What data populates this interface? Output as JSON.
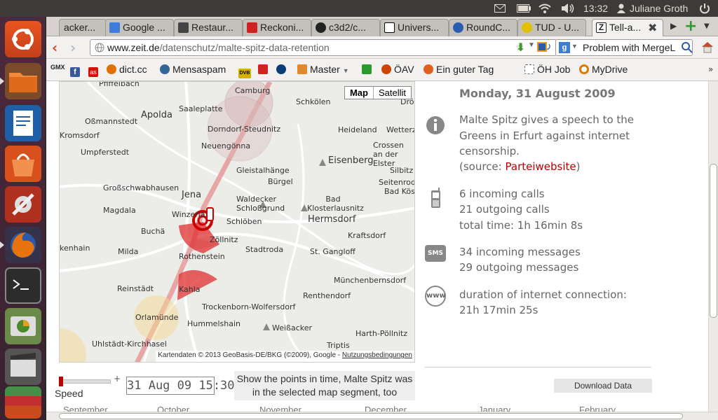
{
  "system": {
    "time": "13:32",
    "user": "Juliane Groth"
  },
  "tabs": [
    {
      "label": "acker...",
      "fav_color": "#555555"
    },
    {
      "label": "Google ...",
      "fav_color": "#3b7dd8"
    },
    {
      "label": "Restaur...",
      "fav_color": "#444444"
    },
    {
      "label": "Reckoni...",
      "fav_color": "#cc2222"
    },
    {
      "label": "c3d2/c...",
      "fav_color": "#222222"
    },
    {
      "label": "Univers...",
      "fav_color": "#000000"
    },
    {
      "label": "RoundC...",
      "fav_color": "#2a5db0"
    },
    {
      "label": "TUD - U...",
      "fav_color": "#e0c000"
    },
    {
      "label": "Tell-a...",
      "fav_color": "#222222"
    }
  ],
  "address": {
    "domain": "www.zeit.de",
    "path": "/datenschutz/malte-spitz-data-retention"
  },
  "search": {
    "text": "Problem with MergeL"
  },
  "bookmarks": [
    {
      "label": "",
      "color": "#333333",
      "text_icon": "GMX"
    },
    {
      "label": "",
      "color": "#3b5998",
      "text_icon": "f"
    },
    {
      "label": "",
      "color": "#d51007",
      "text_icon": "as"
    },
    {
      "label": "dict.cc",
      "color": "#e07000",
      "text_icon": "d"
    },
    {
      "label": "Mensaspam",
      "color": "#336699",
      "text_icon": ""
    },
    {
      "label": "",
      "color": "#d4b000",
      "text_icon": "DVB"
    },
    {
      "label": "",
      "color": "#cc2222",
      "text_icon": ""
    },
    {
      "label": "",
      "color": "#0a3e7a",
      "text_icon": ""
    },
    {
      "label": "Master",
      "color": "#e08a30",
      "text_icon": ""
    },
    {
      "label": "",
      "color": "#2a9a2a",
      "text_icon": ""
    },
    {
      "label": "ÖAV",
      "color": "#cc4400",
      "text_icon": ""
    },
    {
      "label": "Ein guter Tag",
      "color": "#e06020",
      "text_icon": ""
    },
    {
      "label": "ÖH Job",
      "color": "#666666",
      "text_icon": ""
    },
    {
      "label": "MyDrive",
      "color": "#e07a00",
      "text_icon": ""
    }
  ],
  "map": {
    "toggle_map": "Map",
    "toggle_satellite": "Satellit",
    "attribution": "Kartendaten © 2013 GeoBasis-DE/BKG (©2009), Google - ",
    "attribution_link": "Nutzungsbedingungen",
    "places": [
      "Pfiffelbach",
      "Camburg",
      "Schkölen",
      "Apolda",
      "Saaleplatte",
      "Oßmannstedt",
      "Dorndorf-Steudnitz",
      "Heideland",
      "Wetterzeube",
      "Kromsdorf",
      "Neuengönna",
      "Crossen an der Elster",
      "Umpferstedt",
      "Eisenberg",
      "Gleistalhänge",
      "Silbitz",
      "Bürgel",
      "Seitenroda",
      "Großschwabhausen",
      "Jena",
      "Waldecker Schloßgrund",
      "Bad Klosterlausnitz",
      "Bad Köstritz",
      "Magdala",
      "Winzerla",
      "Schlöben",
      "Hermsdorf",
      "Buchä",
      "Zöllnitz",
      "Kraftsdorf",
      "kenhain",
      "Milda",
      "Rothenstein",
      "Stadtroda",
      "St. Gangloff",
      "Münchenbernsdorf",
      "Reinstädt",
      "Kahla",
      "Renthendorf",
      "Trockenborn-Wolfersdorf",
      "Orlamünde",
      "Hummelshain",
      "Weißacker",
      "Harth-Pöllnitz",
      "Uhlstädt-Kirchhasel",
      "Triptis",
      "Drö"
    ]
  },
  "info": {
    "date": "Monday, 31 August 2009",
    "event_text": "Malte Spitz gives a speech to the Greens in Erfurt against internet censorship.",
    "source_prefix": "(source: ",
    "source_link": "Parteiwebsite",
    "source_suffix": ")",
    "calls_in": "6 incoming calls",
    "calls_out": "21 outgoing calls",
    "calls_total": "total time: 1h 16min 8s",
    "sms_icon_label": "SMS",
    "sms_in": "34 incoming messages",
    "sms_out": "29 outgoing messages",
    "www_icon_label": "www",
    "internet": "duration of internet connection:",
    "internet_time": "21h 17min 25s"
  },
  "controls": {
    "speed_label": "Speed",
    "speed_plus": "+",
    "date": "31 Aug 09 15:30",
    "hint": "Show the points in time, Malte Spitz was in the selected map segment, too",
    "download": "Download Data",
    "timeline_months": [
      "September",
      "October",
      "November",
      "December",
      "January",
      "February"
    ]
  }
}
